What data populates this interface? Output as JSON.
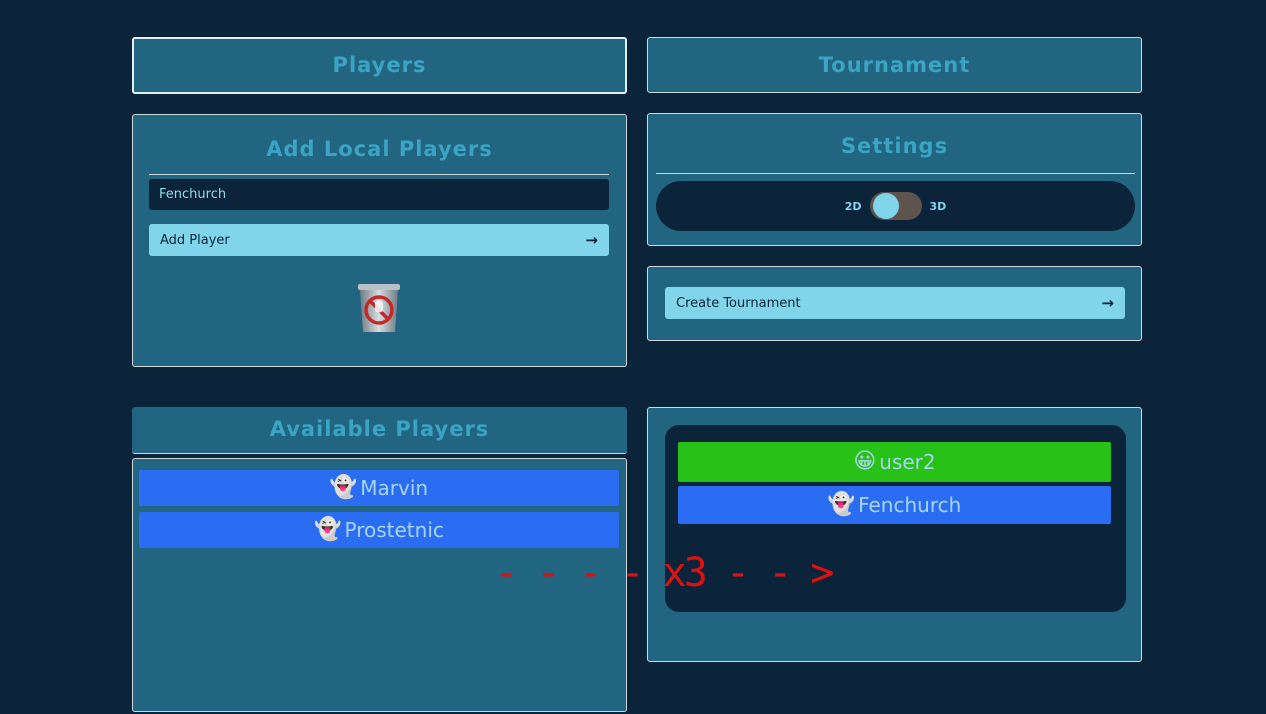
{
  "players_tab": {
    "title": "Players"
  },
  "tournament_tab": {
    "title": "Tournament"
  },
  "add_local": {
    "title": "Add Local Players",
    "input_value": "Fenchurch",
    "add_button": "Add Player"
  },
  "settings": {
    "title": "Settings",
    "label_2d": "2D",
    "label_3d": "3D",
    "mode": "2D"
  },
  "create_tournament": {
    "button": "Create Tournament"
  },
  "available": {
    "title": "Available Players",
    "players": [
      {
        "icon": "👻",
        "name": "Marvin"
      },
      {
        "icon": "👻",
        "name": "Prostetnic"
      }
    ]
  },
  "tournament_players": [
    {
      "icon": "😀",
      "name": "user2"
    },
    {
      "icon": "👻",
      "name": "Fenchurch"
    }
  ],
  "annotation": "- - - - x3 - - >",
  "colors": {
    "accent": "#80d5ea",
    "panel": "#216580",
    "background": "#0b2439",
    "player_blue": "#2a6df3",
    "player_green": "#27c117",
    "annotation_red": "#e01010"
  }
}
